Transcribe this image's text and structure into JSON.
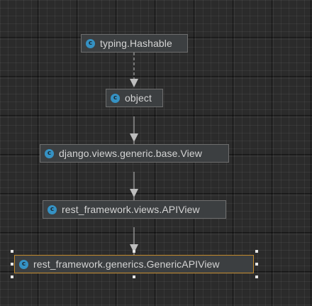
{
  "diagram": {
    "nodes": [
      {
        "id": "n1",
        "label": "typing.Hashable",
        "icon": "class-icon",
        "icon_letter": "c"
      },
      {
        "id": "n2",
        "label": "object",
        "icon": "class-icon",
        "icon_letter": "c"
      },
      {
        "id": "n3",
        "label": "django.views.generic.base.View",
        "icon": "class-icon",
        "icon_letter": "c"
      },
      {
        "id": "n4",
        "label": "rest_framework.views.APIView",
        "icon": "class-icon",
        "icon_letter": "c"
      },
      {
        "id": "n5",
        "label": "rest_framework.generics.GenericAPIView",
        "icon": "class-icon",
        "icon_letter": "c",
        "selected": true
      }
    ],
    "edges": [
      {
        "from": "n1",
        "to": "n2",
        "style": "dashed"
      },
      {
        "from": "n3",
        "to": "n2",
        "style": "solid"
      },
      {
        "from": "n4",
        "to": "n3",
        "style": "solid"
      },
      {
        "from": "n5",
        "to": "n4",
        "style": "solid"
      }
    ],
    "colors": {
      "background": "#2b2b2b",
      "node_fill": "#3c3f41",
      "node_border": "#6e6e6e",
      "selected_border": "#c28a2c",
      "edge": "#bdbdbd",
      "class_icon": "#3592c4"
    }
  }
}
